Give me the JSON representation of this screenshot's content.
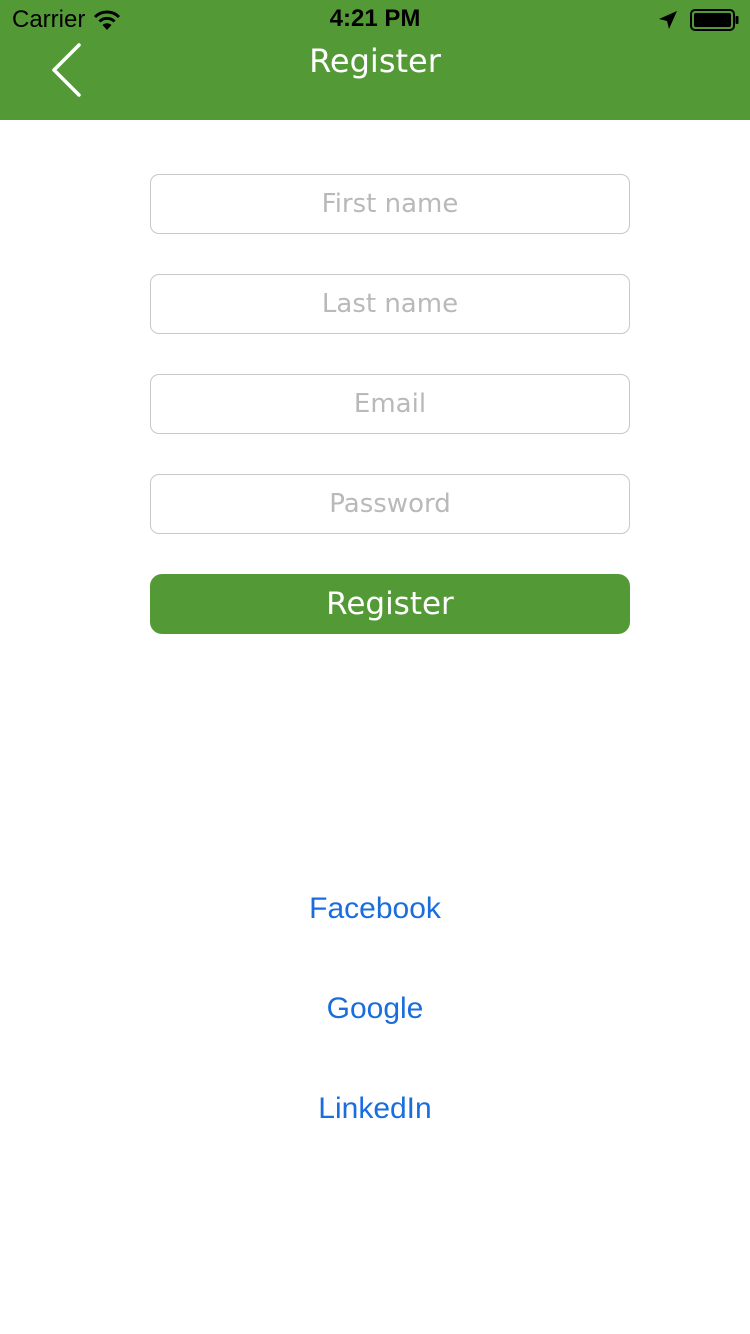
{
  "status_bar": {
    "carrier": "Carrier",
    "time": "4:21 PM",
    "icons": [
      "wifi-icon",
      "location-arrow-icon",
      "battery-icon"
    ]
  },
  "nav": {
    "title": "Register",
    "back_icon": "chevron-left-icon"
  },
  "form": {
    "first_name": {
      "placeholder": "First name",
      "value": ""
    },
    "last_name": {
      "placeholder": "Last name",
      "value": ""
    },
    "email": {
      "placeholder": "Email",
      "value": ""
    },
    "password": {
      "placeholder": "Password",
      "value": ""
    },
    "register_label": "Register"
  },
  "social": {
    "facebook": "Facebook",
    "google": "Google",
    "linkedin": "LinkedIn"
  },
  "colors": {
    "brand_green": "#539a36",
    "link_blue": "#1a6ddc",
    "placeholder_gray": "#b9b9b9",
    "border_gray": "#c8c8c8"
  }
}
